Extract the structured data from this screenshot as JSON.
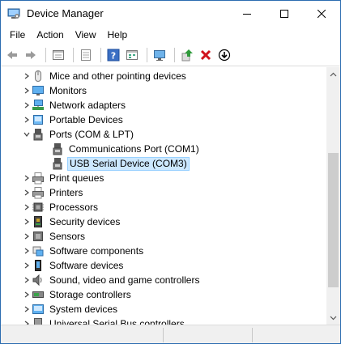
{
  "window": {
    "title": "Device Manager",
    "controls": [
      "minimize",
      "maximize",
      "close"
    ]
  },
  "menu": [
    "File",
    "Action",
    "View",
    "Help"
  ],
  "toolbar": {
    "buttons": [
      "back-arrow-icon",
      "forward-arrow-icon",
      "properties-icon",
      "driver-details-icon",
      "help-icon",
      "view-icon",
      "monitor-icon",
      "update-driver-icon",
      "uninstall-x-icon",
      "download-circle-icon"
    ]
  },
  "tree": {
    "items": [
      {
        "label": "Mice and other pointing devices",
        "icon": "mouse-icon",
        "level": 1,
        "expanded": false
      },
      {
        "label": "Monitors",
        "icon": "monitor-icon",
        "level": 1,
        "expanded": false
      },
      {
        "label": "Network adapters",
        "icon": "network-icon",
        "level": 1,
        "expanded": false
      },
      {
        "label": "Portable Devices",
        "icon": "portable-device-icon",
        "level": 1,
        "expanded": false
      },
      {
        "label": "Ports (COM & LPT)",
        "icon": "port-icon",
        "level": 1,
        "expanded": true
      },
      {
        "label": "Communications Port (COM1)",
        "icon": "port-icon",
        "level": 2,
        "selected": false
      },
      {
        "label": "USB Serial Device (COM3)",
        "icon": "port-icon",
        "level": 2,
        "selected": true
      },
      {
        "label": "Print queues",
        "icon": "printer-icon",
        "level": 1,
        "expanded": false
      },
      {
        "label": "Printers",
        "icon": "printer-icon",
        "level": 1,
        "expanded": false
      },
      {
        "label": "Processors",
        "icon": "processor-icon",
        "level": 1,
        "expanded": false
      },
      {
        "label": "Security devices",
        "icon": "security-device-icon",
        "level": 1,
        "expanded": false
      },
      {
        "label": "Sensors",
        "icon": "sensor-icon",
        "level": 1,
        "expanded": false
      },
      {
        "label": "Software components",
        "icon": "software-component-icon",
        "level": 1,
        "expanded": false
      },
      {
        "label": "Software devices",
        "icon": "software-device-icon",
        "level": 1,
        "expanded": false
      },
      {
        "label": "Sound, video and game controllers",
        "icon": "speaker-icon",
        "level": 1,
        "expanded": false
      },
      {
        "label": "Storage controllers",
        "icon": "storage-icon",
        "level": 1,
        "expanded": false
      },
      {
        "label": "System devices",
        "icon": "system-device-icon",
        "level": 1,
        "expanded": false
      },
      {
        "label": "Universal Serial Bus controllers",
        "icon": "usb-icon",
        "level": 1,
        "expanded": false
      }
    ]
  },
  "colors": {
    "selection_bg": "#cce8ff",
    "selection_border": "#99d1ff",
    "window_border": "#2b6cb0"
  }
}
